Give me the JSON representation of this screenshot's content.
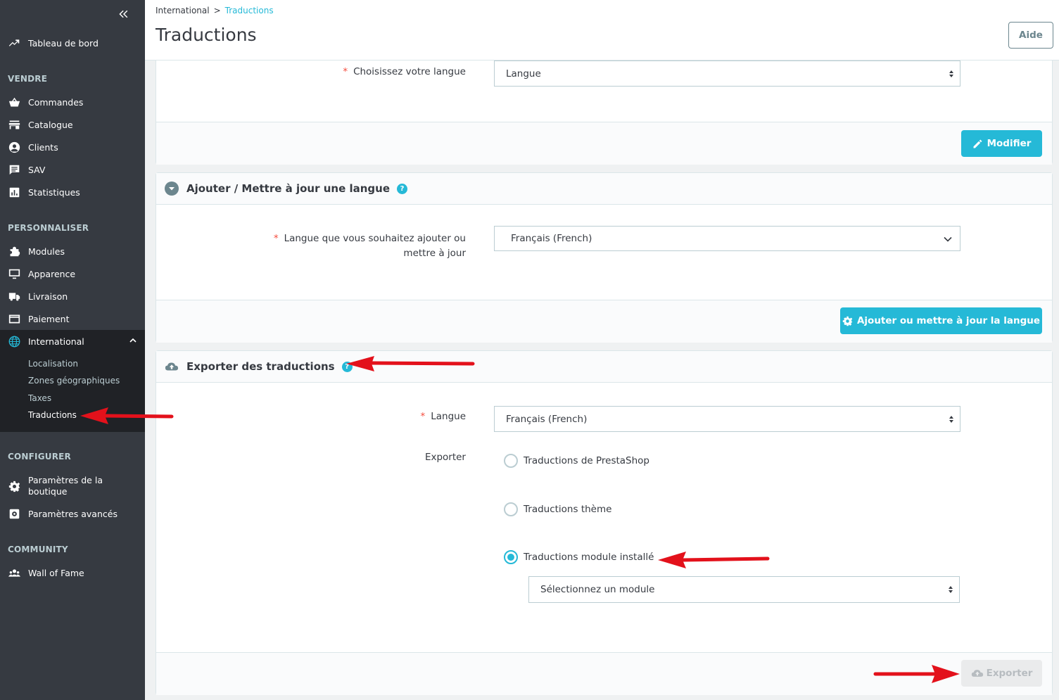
{
  "sidebar": {
    "dashboard": "Tableau de bord",
    "sections": {
      "sell": "VENDRE",
      "customize": "PERSONNALISER",
      "configure": "CONFIGURER",
      "community": "COMMUNITY"
    },
    "sell_items": [
      "Commandes",
      "Catalogue",
      "Clients",
      "SAV",
      "Statistiques"
    ],
    "customize_items": [
      "Modules",
      "Apparence",
      "Livraison",
      "Paiement",
      "International"
    ],
    "international_sub": [
      "Localisation",
      "Zones géographiques",
      "Taxes",
      "Traductions"
    ],
    "configure_items": [
      "Paramètres de la boutique",
      "Paramètres avancés"
    ],
    "community_items": [
      "Wall of Fame"
    ]
  },
  "header": {
    "breadcrumb_parent": "International",
    "breadcrumb_sep": ">",
    "breadcrumb_current": "Traductions",
    "title": "Traductions",
    "help_label": "Aide"
  },
  "panel_modify": {
    "label": "Choisissez votre langue",
    "select_value": "Langue",
    "button": "Modifier"
  },
  "panel_add": {
    "title": "Ajouter / Mettre à jour une langue",
    "help": "?",
    "label_line1": "Langue que vous souhaitez ajouter ou",
    "label_line2": "mettre à jour",
    "select_value": "Français (French)",
    "button": "Ajouter ou mettre à jour la langue"
  },
  "panel_export": {
    "title": "Exporter des traductions",
    "help": "?",
    "lang_label": "Langue",
    "lang_value": "Français (French)",
    "export_label": "Exporter",
    "radios": [
      {
        "label": "Traductions de PrestaShop",
        "checked": false
      },
      {
        "label": "Traductions thème",
        "checked": false
      },
      {
        "label": "Traductions module installé",
        "checked": true
      }
    ],
    "module_select": "Sélectionnez un module",
    "button": "Exporter"
  },
  "required_mark": "*",
  "colors": {
    "sidebar": "#363a41",
    "sidebar_active": "#202226",
    "accent": "#25b9d7",
    "arrow": "#e3111b",
    "required": "#f54c3e"
  }
}
